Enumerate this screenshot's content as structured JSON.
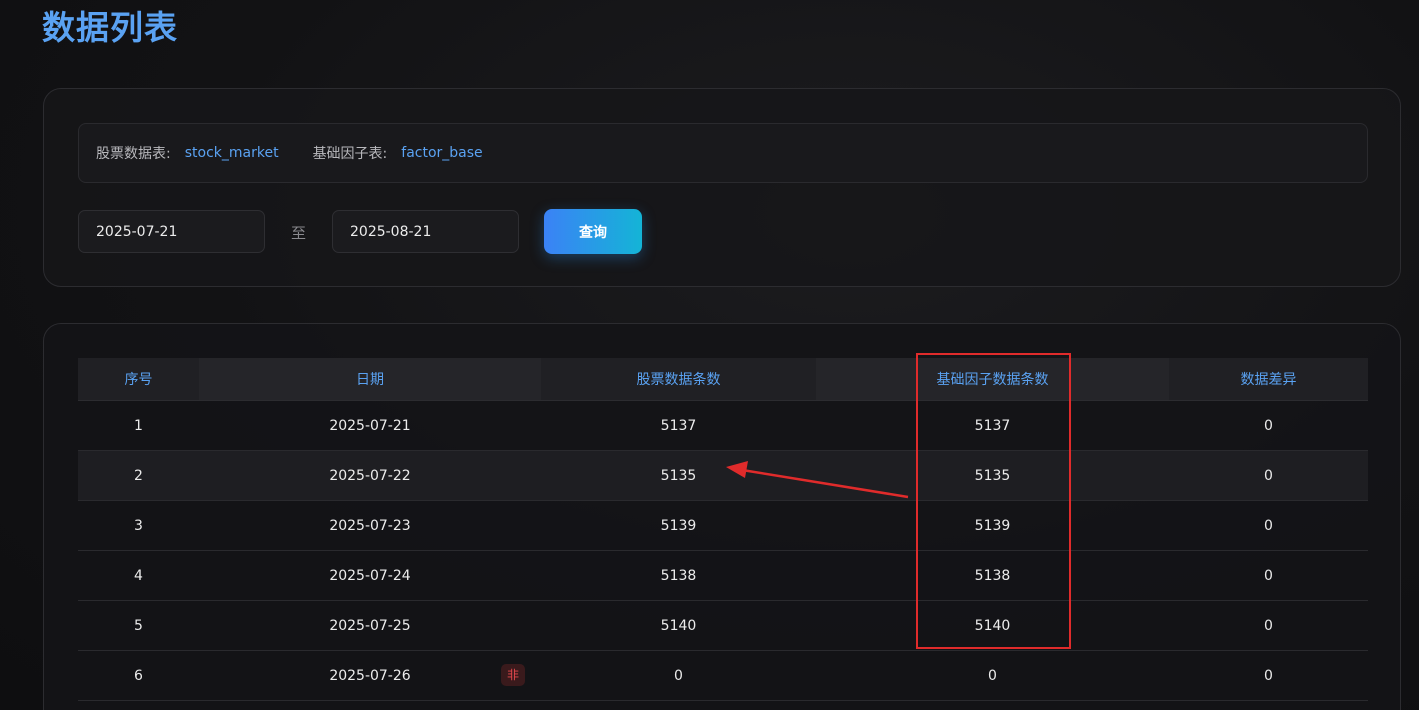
{
  "page": {
    "title": "数据列表"
  },
  "source": {
    "stock_label": "股票数据表:",
    "stock_value": "stock_market",
    "factor_label": "基础因子表:",
    "factor_value": "factor_base"
  },
  "filter": {
    "start_date": "2025-07-21",
    "separator": "至",
    "end_date": "2025-08-21",
    "query_label": "查询"
  },
  "table": {
    "headers": [
      "序号",
      "日期",
      "股票数据条数",
      "基础因子数据条数",
      "数据差异"
    ],
    "rows": [
      {
        "index": "1",
        "date": "2025-07-21",
        "stock_count": "5137",
        "factor_count": "5137",
        "diff": "0"
      },
      {
        "index": "2",
        "date": "2025-07-22",
        "stock_count": "5135",
        "factor_count": "5135",
        "diff": "0"
      },
      {
        "index": "3",
        "date": "2025-07-23",
        "stock_count": "5139",
        "factor_count": "5139",
        "diff": "0"
      },
      {
        "index": "4",
        "date": "2025-07-24",
        "stock_count": "5138",
        "factor_count": "5138",
        "diff": "0"
      },
      {
        "index": "5",
        "date": "2025-07-25",
        "stock_count": "5140",
        "factor_count": "5140",
        "diff": "0"
      },
      {
        "index": "6",
        "date": "2025-07-26",
        "badge": "非",
        "stock_count": "0",
        "factor_count": "0",
        "diff": "0"
      }
    ]
  },
  "colors": {
    "accent": "#5aa2f2",
    "annotation": "#e02b2b",
    "badge_text": "#e5484d"
  }
}
